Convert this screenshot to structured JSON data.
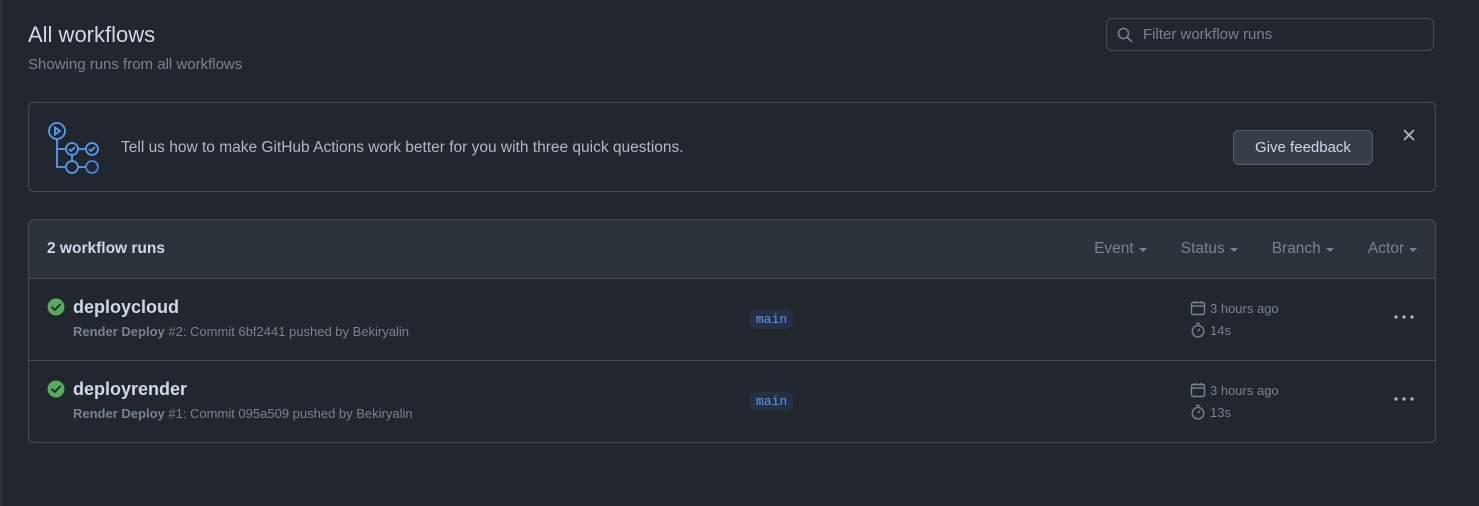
{
  "header": {
    "title": "All workflows",
    "subtitle": "Showing runs from all workflows"
  },
  "search": {
    "placeholder": "Filter workflow runs",
    "value": ""
  },
  "banner": {
    "text": "Tell us how to make GitHub Actions work better for you with three quick questions.",
    "button_label": "Give feedback"
  },
  "runs": {
    "count_label": "2 workflow runs",
    "filters": [
      "Event",
      "Status",
      "Branch",
      "Actor"
    ],
    "items": [
      {
        "title": "deploycloud",
        "workflow": "Render Deploy",
        "meta": " #2: Commit 6bf2441 pushed by Bekiryalin",
        "branch": "main",
        "time_ago": "3 hours ago",
        "duration": "14s"
      },
      {
        "title": "deployrender",
        "workflow": "Render Deploy",
        "meta": " #1: Commit 095a509 pushed by Bekiryalin",
        "branch": "main",
        "time_ago": "3 hours ago",
        "duration": "13s"
      }
    ]
  },
  "colors": {
    "background": "#22272e",
    "success": "#57ab5a",
    "accent": "#539bf5"
  }
}
